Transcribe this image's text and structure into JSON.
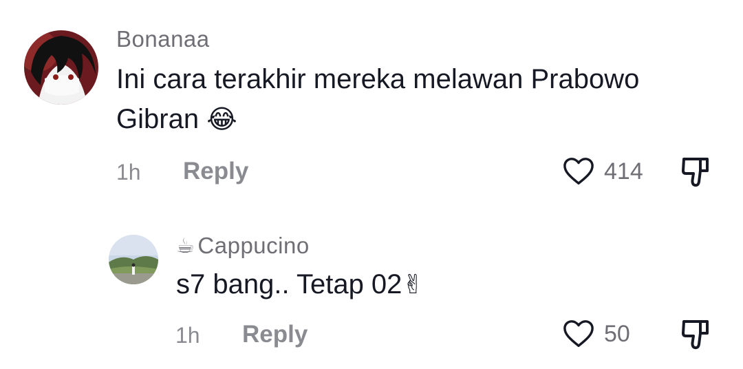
{
  "comments": [
    {
      "username": "Bonanaa",
      "text": "Ini cara terakhir mereka melawan Prabowo Gibran",
      "emoji": "😂",
      "time": "1h",
      "reply_label": "Reply",
      "likes": "414",
      "avatar_icon": "anime-avatar"
    },
    {
      "username_emoji": "☕",
      "username": "Cappucino",
      "text": "s7 bang.. Tetap 02",
      "emoji": "✌",
      "time": "1h",
      "reply_label": "Reply",
      "likes": "50",
      "avatar_icon": "landscape-avatar"
    }
  ],
  "colors": {
    "text": "#161823",
    "secondary": "#8a8b91",
    "username": "#6e6e75",
    "icon_stroke": "#161823"
  }
}
